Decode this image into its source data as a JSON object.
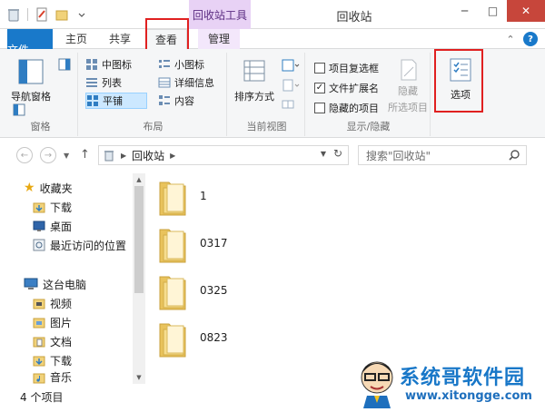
{
  "window": {
    "title": "回收站",
    "contextual_tab_group": "回收站工具",
    "controls": {
      "minimize": "─",
      "maximize": "□",
      "close": "✕"
    }
  },
  "ribbon_tabs": [
    "文件",
    "主页",
    "共享",
    "查看",
    "管理"
  ],
  "ribbon_tools": {
    "collapse": "⌃",
    "help": "?"
  },
  "ribbon": {
    "panes": {
      "navigation_pane": "导航窗格",
      "label": "窗格"
    },
    "layout": {
      "medium_icons": "中图标",
      "small_icons": "小图标",
      "list": "列表",
      "details": "详细信息",
      "tiles": "平铺",
      "content": "内容",
      "label": "布局",
      "selected": "平铺"
    },
    "current_view": {
      "sort_by": "排序方式",
      "label": "当前视图"
    },
    "show_hide": {
      "item_check_boxes": {
        "label": "项目复选框",
        "checked": false
      },
      "file_name_extensions": {
        "label": "文件扩展名",
        "checked": true
      },
      "hidden_items": {
        "label": "隐藏的项目",
        "checked": false
      },
      "hide_selected_line1": "隐藏",
      "hide_selected_line2": "所选项目",
      "label": "显示/隐藏"
    },
    "options": {
      "label": "选项"
    }
  },
  "address_bar": {
    "location": "回收站",
    "search_placeholder": "搜索\"回收站\""
  },
  "nav_pane": {
    "favorites": "收藏夹",
    "favorites_items": [
      "下载",
      "桌面",
      "最近访问的位置"
    ],
    "this_pc": "这台电脑",
    "this_pc_items": [
      "视频",
      "图片",
      "文档",
      "下载",
      "音乐"
    ]
  },
  "files": [
    "1",
    "0317",
    "0325",
    "0823"
  ],
  "status": {
    "item_count": "4 个项目"
  },
  "watermark": {
    "title": "系统哥软件园",
    "url": "www.xitongge.com"
  },
  "colors": {
    "accent": "#1979ca",
    "contextual": "#e8d2f5",
    "highlight_box": "#e02020",
    "folder": "#f1d27a"
  }
}
